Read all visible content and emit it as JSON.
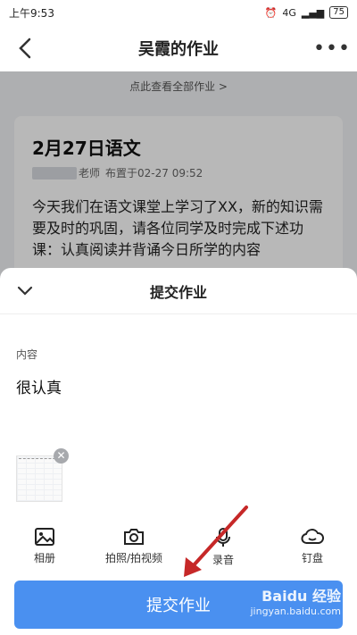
{
  "status_bar": {
    "time": "上午9:53",
    "network": "4G",
    "battery": "75"
  },
  "header": {
    "title": "吴霞的作业"
  },
  "homework": {
    "view_all": "点此查看全部作业 >",
    "title": "2月27日语文",
    "teacher_suffix": "老师",
    "posted": "布置于02-27 09:52",
    "body": "今天我们在语文课堂上学习了XX，新的知识需要及时的巩固，请各位同学及时完成下述功课：认真阅读并背诵今日所学的内容"
  },
  "sheet": {
    "title": "提交作业",
    "content_label": "内容",
    "content_text": "很认真",
    "tools": [
      {
        "label": "相册",
        "icon": "image-icon"
      },
      {
        "label": "拍照/拍视频",
        "icon": "camera-icon"
      },
      {
        "label": "录音",
        "icon": "microphone-icon"
      },
      {
        "label": "钉盘",
        "icon": "cloud-icon"
      }
    ],
    "submit_label": "提交作业"
  },
  "watermark": {
    "brand": "Baidu 经验",
    "url": "jingyan.baidu.com"
  },
  "colors": {
    "primary": "#4a90f0",
    "arrow": "#c62828"
  }
}
